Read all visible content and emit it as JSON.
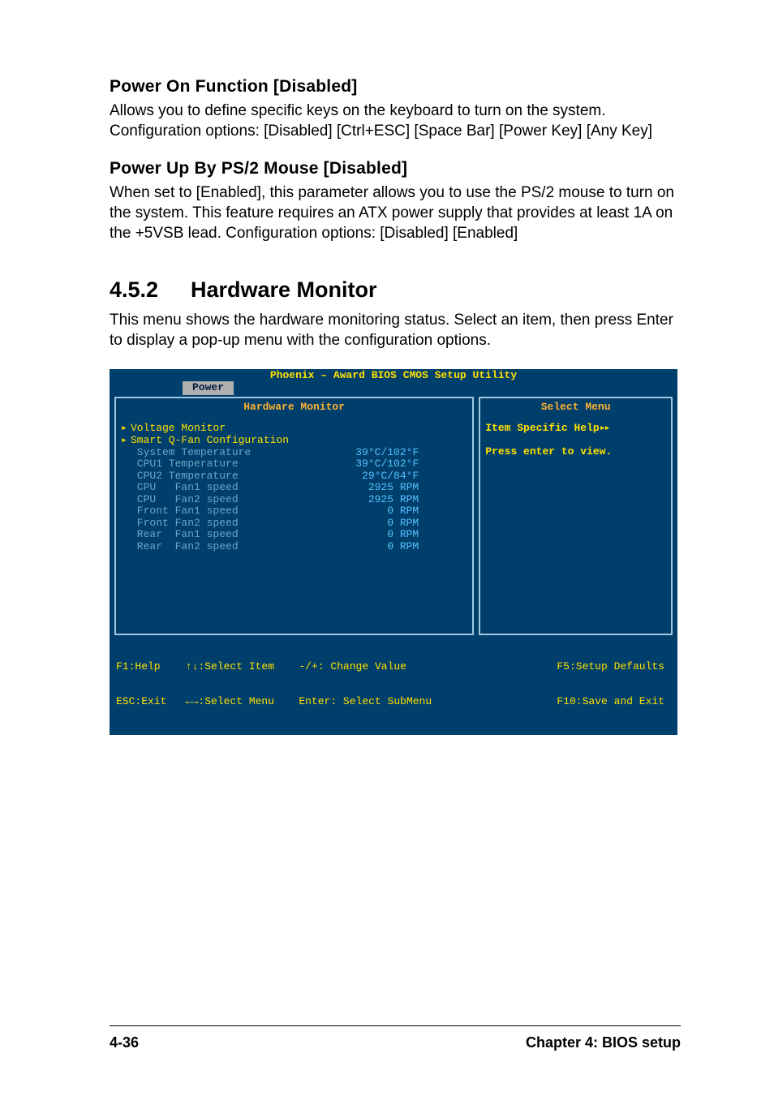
{
  "sec1": {
    "title": "Power On Function [Disabled]",
    "body": "Allows you to define specific keys on the keyboard to turn on the system. Configuration options: [Disabled] [Ctrl+ESC] [Space Bar] [Power Key] [Any Key]"
  },
  "sec2": {
    "title": "Power Up By PS/2 Mouse [Disabled]",
    "body": "When set to [Enabled], this parameter allows you to use the PS/2 mouse to turn on the system. This feature requires an ATX power supply that provides at least 1A on the +5VSB lead. Configuration options: [Disabled] [Enabled]"
  },
  "sec3": {
    "num": "4.5.2",
    "title": "Hardware Monitor",
    "body": "This menu shows the hardware monitoring status. Select an item, then press Enter to display a pop-up menu with the configuration options."
  },
  "bios": {
    "title": "Phoenix – Award BIOS CMOS Setup Utility",
    "tab": "Power",
    "left_header": "Hardware Monitor",
    "right_header": "Select Menu",
    "help_title": "Item Specific Help",
    "help_arrows": "▸▸",
    "help_body": "Press enter to view.",
    "items": [
      {
        "caret": "▸",
        "label": "Voltage Monitor",
        "val": "",
        "cls": "submenu"
      },
      {
        "caret": "▸",
        "label": "Smart Q-Fan Configuration",
        "val": "",
        "cls": "submenu"
      },
      {
        "caret": "",
        "label": " System Temperature",
        "val": "39°C/102°F",
        "cls": "non"
      },
      {
        "caret": "",
        "label": " CPU1 Temperature",
        "val": "39°C/102°F",
        "cls": "non"
      },
      {
        "caret": "",
        "label": " CPU2 Temperature",
        "val": " 29°C/84°F",
        "cls": "non"
      },
      {
        "caret": "",
        "label": " CPU   Fan1 speed",
        "val": "2925 RPM",
        "cls": "non"
      },
      {
        "caret": "",
        "label": " CPU   Fan2 speed",
        "val": "2925 RPM",
        "cls": "non"
      },
      {
        "caret": "",
        "label": " Front Fan1 speed",
        "val": "   0 RPM",
        "cls": "non"
      },
      {
        "caret": "",
        "label": " Front Fan2 speed",
        "val": "   0 RPM",
        "cls": "non"
      },
      {
        "caret": "",
        "label": " Rear  Fan1 speed",
        "val": "   0 RPM",
        "cls": "non"
      },
      {
        "caret": "",
        "label": " Rear  Fan2 speed",
        "val": "   0 RPM",
        "cls": "non"
      }
    ],
    "footer": {
      "c1a": "F1:Help    ↑↓:Select Item",
      "c1b": "ESC:Exit   ←→:Select Menu",
      "c2a": "-/+: Change Value",
      "c2b": "Enter: Select SubMenu",
      "c3a": "F5:Setup Defaults",
      "c3b": "F10:Save and Exit"
    }
  },
  "page_footer": {
    "left": "4-36",
    "right": "Chapter 4: BIOS setup"
  }
}
